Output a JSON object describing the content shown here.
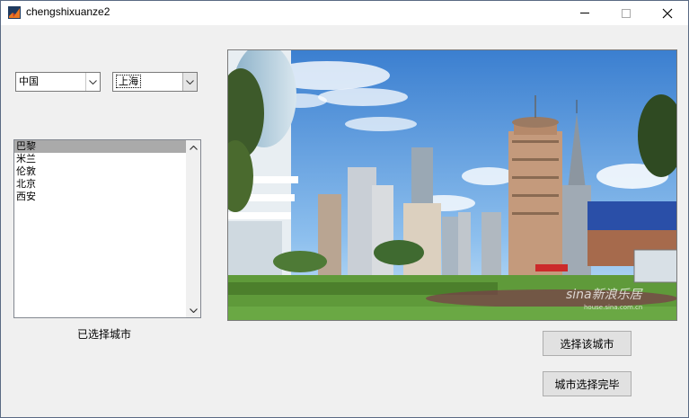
{
  "window": {
    "title": "chengshixuanze2"
  },
  "country_select": {
    "value": "中国"
  },
  "city_select": {
    "value": "上海"
  },
  "city_list": {
    "items": [
      "巴黎",
      "米兰",
      "伦敦",
      "北京",
      "西安"
    ],
    "selected_index": 0
  },
  "selected_caption": "已选择城市",
  "image": {
    "watermark": "sina新浪乐居",
    "watermark_url": "house.sina.com.cn"
  },
  "buttons": {
    "select_city": "选择该城市",
    "done": "城市选择完毕"
  }
}
